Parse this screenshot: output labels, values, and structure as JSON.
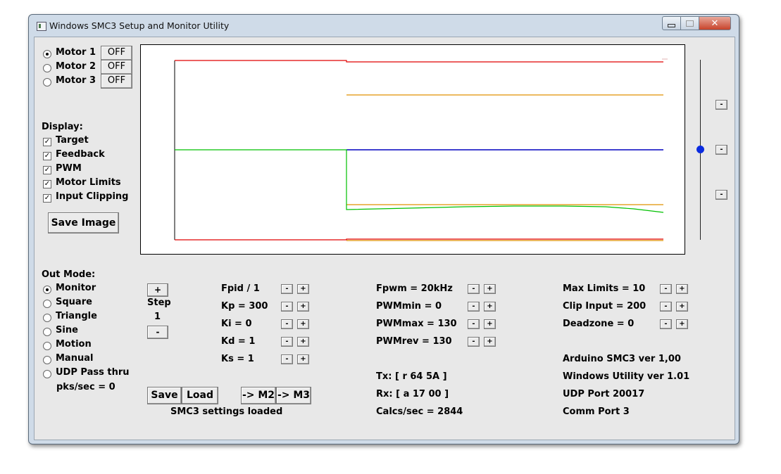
{
  "window": {
    "title": "Windows SMC3 Setup and Monitor Utility",
    "controls": {
      "close": "✕"
    }
  },
  "motors": [
    {
      "label": "Motor 1",
      "selected": true,
      "state": "OFF"
    },
    {
      "label": "Motor 2",
      "selected": false,
      "state": "OFF"
    },
    {
      "label": "Motor 3",
      "selected": false,
      "state": "OFF"
    }
  ],
  "display": {
    "heading": "Display:",
    "items": [
      {
        "label": "Target",
        "checked": true
      },
      {
        "label": "Feedback",
        "checked": true
      },
      {
        "label": "PWM",
        "checked": true
      },
      {
        "label": "Motor Limits",
        "checked": true
      },
      {
        "label": "Input Clipping",
        "checked": true
      }
    ],
    "save_image": "Save Image"
  },
  "out_mode": {
    "heading": "Out Mode:",
    "items": [
      {
        "label": "Monitor",
        "selected": true
      },
      {
        "label": "Square",
        "selected": false
      },
      {
        "label": "Triangle",
        "selected": false
      },
      {
        "label": "Sine",
        "selected": false
      },
      {
        "label": "Motion",
        "selected": false
      },
      {
        "label": "Manual",
        "selected": false
      },
      {
        "label": "UDP Pass thru",
        "selected": false
      }
    ],
    "pks_sec": "pks/sec = 0"
  },
  "step": {
    "plus": "+",
    "label": "Step",
    "value": "1",
    "minus": "-"
  },
  "pid": [
    "Fpid / 1",
    "Kp = 300",
    "Ki = 0",
    "Kd = 1",
    "Ks = 1"
  ],
  "pwm": [
    "Fpwm = 20kHz",
    "PWMmin = 0",
    "PWMmax = 130",
    "PWMrev = 130"
  ],
  "limits": [
    "Max Limits = 10",
    "Clip Input = 200",
    "Deadzone = 0"
  ],
  "adjust": {
    "minus": "-",
    "plus": "+"
  },
  "comms": {
    "tx": "Tx: [ r 64 5A ]",
    "rx": "Rx: [ a 17 00 ]",
    "calcs": "Calcs/sec = 2844"
  },
  "info": [
    "Arduino SMC3 ver 1,00",
    "Windows Utility ver 1.01",
    "UDP Port 20017",
    "Comm Port 3"
  ],
  "actions": {
    "save": "Save",
    "load": "Load",
    "to_m2": "-> M2",
    "to_m3": "-> M3",
    "status": "SMC3 settings loaded"
  },
  "slider": {
    "buttons": [
      "-",
      "-",
      "-"
    ],
    "thumb_color": "#0a2be0"
  },
  "plot_colors": {
    "target": "#e00000",
    "limit": "#e09000",
    "feedback": "#0000c0",
    "pwm": "#00c000"
  }
}
